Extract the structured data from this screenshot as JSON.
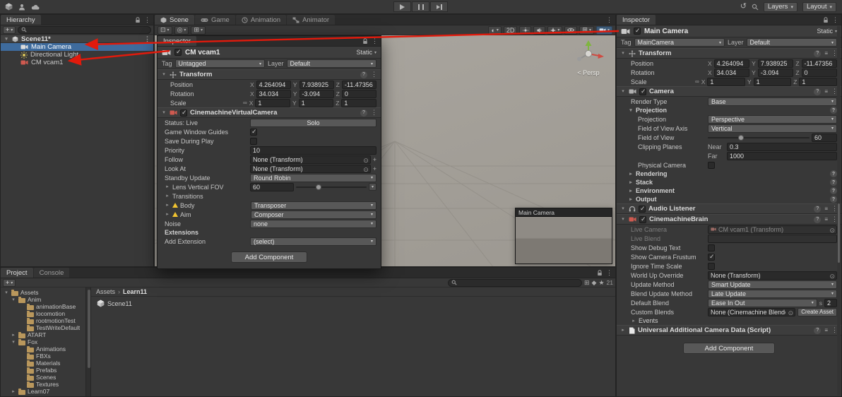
{
  "colors": {
    "selection_blue": "#3e6b9d",
    "annotation_arrow": "#e11a0c",
    "scene_background": "#a6a29c",
    "warning_yellow": "#f0c330",
    "cinemachine_red": "#cf5a50",
    "folder_tan": "#b9975c"
  },
  "icons": {
    "foldout_open": "▾",
    "foldout_closed": "▸",
    "menu": "⋮",
    "object_picker": "⊙",
    "dropdown_caret": "▾",
    "checkmark": "✓",
    "scale_link": "∞",
    "help": "?",
    "presets": "≡",
    "search": "magnifier-svg",
    "lock": "padlock-svg",
    "warning": "yellow-triangle"
  },
  "topbar": {
    "layers_label": "Layers",
    "layout_label": "Layout"
  },
  "hierarchy": {
    "tab_label": "Hierarchy",
    "add_button": "+",
    "scene_row_label": "Scene11*",
    "items": [
      {
        "label": "Main Camera"
      },
      {
        "label": "Directional Light"
      },
      {
        "label": "CM vcam1"
      }
    ]
  },
  "scene": {
    "tabs": [
      {
        "label": "Scene"
      },
      {
        "label": "Game"
      },
      {
        "label": "Animation"
      },
      {
        "label": "Animator"
      }
    ],
    "toolbar_2d": "2D",
    "persp_label": "< Persp",
    "camera_preview_title": "Main Camera"
  },
  "vcam_inspector": {
    "tab_label": "Inspector",
    "header": {
      "name": "CM vcam1",
      "static_label": "Static"
    },
    "tag": {
      "label": "Tag",
      "value": "Untagged"
    },
    "layer": {
      "label": "Layer",
      "value": "Default"
    },
    "transform": {
      "title": "Transform",
      "axes": {
        "x": "X",
        "y": "Y",
        "z": "Z"
      },
      "position": {
        "label": "Position",
        "x": "4.264094",
        "y": "7.938925",
        "z": "-11.47356"
      },
      "rotation": {
        "label": "Rotation",
        "x": "34.034",
        "y": "-3.094",
        "z": "0"
      },
      "scale": {
        "label": "Scale",
        "x": "1",
        "y": "1",
        "z": "1"
      }
    },
    "vcam": {
      "title": "CinemachineVirtualCamera",
      "status_label": "Status: Live",
      "solo_button": "Solo",
      "guides_label": "Game Window Guides",
      "save_during_play_label": "Save During Play",
      "priority_label": "Priority",
      "priority_value": "10",
      "follow_label": "Follow",
      "follow_value": "None (Transform)",
      "look_at_label": "Look At",
      "look_at_value": "None (Transform)",
      "standby_label": "Standby Update",
      "standby_value": "Round Robin",
      "lens_label": "Lens Vertical FOV",
      "lens_value": "60",
      "transitions_label": "Transitions",
      "body_label": "Body",
      "body_value": "Transposer",
      "aim_label": "Aim",
      "aim_value": "Composer",
      "noise_label": "Noise",
      "noise_value": "none",
      "extensions_label": "Extensions",
      "add_extension_label": "Add Extension",
      "add_extension_value": "(select)",
      "checkbox_states": {
        "game_window_guides": true,
        "save_during_play": false
      }
    },
    "add_component_button": "Add Component"
  },
  "inspector": {
    "tab_label": "Inspector",
    "header": {
      "name": "Main Camera",
      "static_label": "Static"
    },
    "tag": {
      "label": "Tag",
      "value": "MainCamera"
    },
    "layer": {
      "label": "Layer",
      "value": "Default"
    },
    "transform": {
      "title": "Transform",
      "axes": {
        "x": "X",
        "y": "Y",
        "z": "Z"
      },
      "position": {
        "label": "Position",
        "x": "4.264094",
        "y": "7.938925",
        "z": "-11.47356"
      },
      "rotation": {
        "label": "Rotation",
        "x": "34.034",
        "y": "-3.094",
        "z": "0"
      },
      "scale": {
        "label": "Scale",
        "x": "1",
        "y": "1",
        "z": "1"
      }
    },
    "camera": {
      "title": "Camera",
      "render_type_label": "Render Type",
      "render_type_value": "Base",
      "projection_section": "Projection",
      "projection_label": "Projection",
      "projection_value": "Perspective",
      "fov_axis_label": "Field of View Axis",
      "fov_axis_value": "Vertical",
      "fov_label": "Field of View",
      "fov_value": "60",
      "clipping_label": "Clipping Planes",
      "near_label": "Near",
      "near_value": "0.3",
      "far_label": "Far",
      "far_value": "1000",
      "physical_label": "Physical Camera",
      "physical_checked": false,
      "sections": [
        {
          "label": "Rendering"
        },
        {
          "label": "Stack"
        },
        {
          "label": "Environment"
        },
        {
          "label": "Output"
        }
      ]
    },
    "audio_listener_title": "Audio Listener",
    "brain": {
      "title": "CinemachineBrain",
      "live_camera_label": "Live Camera",
      "live_camera_value": "CM vcam1 (Transform)",
      "live_blend_label": "Live Blend",
      "live_blend_value": "",
      "show_debug_label": "Show Debug Text",
      "show_frustum_label": "Show Camera Frustum",
      "ignore_timescale_label": "Ignore Time Scale",
      "world_up_label": "World Up Override",
      "world_up_value": "None (Transform)",
      "update_method_label": "Update Method",
      "update_method_value": "Smart Update",
      "blend_update_label": "Blend Update Method",
      "blend_update_value": "Late Update",
      "default_blend_label": "Default Blend",
      "default_blend_value": "Ease In Out",
      "seconds_label": "s",
      "blend_time_value": "2",
      "custom_blends_label": "Custom Blends",
      "custom_blends_value": "None (Cinemachine Blender Sett",
      "create_asset_button": "Create Asset",
      "events_label": "Events",
      "checkbox_states": {
        "show_debug_text": false,
        "show_camera_frustum": true,
        "ignore_time_scale": false
      }
    },
    "camera_data_title": "Universal Additional Camera Data (Script)",
    "add_component_button": "Add Component"
  },
  "project": {
    "tabs": [
      {
        "label": "Project"
      },
      {
        "label": "Console"
      }
    ],
    "add_button": "+",
    "count_badge": "21",
    "breadcrumb": {
      "root": "Assets",
      "separator": "›",
      "current": "Learn11"
    },
    "tree": [
      {
        "label": "Assets",
        "depth": 0,
        "state": "open"
      },
      {
        "label": "Anim",
        "depth": 1,
        "state": "open"
      },
      {
        "label": "animationBase",
        "depth": 2,
        "state": "leaf"
      },
      {
        "label": "locomotion",
        "depth": 2,
        "state": "leaf"
      },
      {
        "label": "rootmotionTest",
        "depth": 2,
        "state": "leaf"
      },
      {
        "label": "TestWriteDefault",
        "depth": 2,
        "state": "leaf"
      },
      {
        "label": "ATART",
        "depth": 1,
        "state": "closed"
      },
      {
        "label": "Fox",
        "depth": 1,
        "state": "open"
      },
      {
        "label": "Animations",
        "depth": 2,
        "state": "leaf"
      },
      {
        "label": "FBXs",
        "depth": 2,
        "state": "leaf"
      },
      {
        "label": "Materials",
        "depth": 2,
        "state": "leaf"
      },
      {
        "label": "Prefabs",
        "depth": 2,
        "state": "leaf"
      },
      {
        "label": "Scenes",
        "depth": 2,
        "state": "leaf"
      },
      {
        "label": "Textures",
        "depth": 2,
        "state": "leaf"
      },
      {
        "label": "Learn07",
        "depth": 1,
        "state": "closed"
      }
    ],
    "items": [
      {
        "label": "Scene11"
      }
    ]
  }
}
